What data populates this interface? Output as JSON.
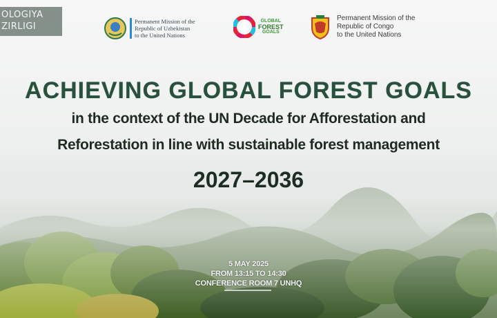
{
  "top_bar": {
    "corner_line1": "OLOGIYA",
    "corner_line2": "ZIRLIGI"
  },
  "logos": {
    "uzbekistan": {
      "line1": "Permanent Mission of the",
      "line2": "Republic of Uzbekistan",
      "line3": "to the United Nations",
      "icon": "uzbekistan-emblem"
    },
    "gfg": {
      "line1": "GLOBAL",
      "line2": "FOREST",
      "line3": "GOALS",
      "icon": "sdg-wheel"
    },
    "congo": {
      "line1": "Permanent Mission of the",
      "line2": "Republic of Congo",
      "line3": "to the United Nations",
      "icon": "congo-coat-of-arms"
    }
  },
  "heading": {
    "title": "ACHIEVING GLOBAL FOREST GOALS",
    "subtitle_line1": "in the context of the UN Decade for Afforestation and",
    "subtitle_line2": "Reforestation in line with sustainable forest management",
    "years": "2027–2036"
  },
  "event": {
    "date": "5 MAY 2025",
    "time": "FROM 13:15 TO 14:30",
    "room": "CONFERENCE ROOM 7 UNHQ"
  },
  "colors": {
    "title": "#28503d",
    "text": "#1f2a22",
    "forest": "#3f5d33"
  }
}
